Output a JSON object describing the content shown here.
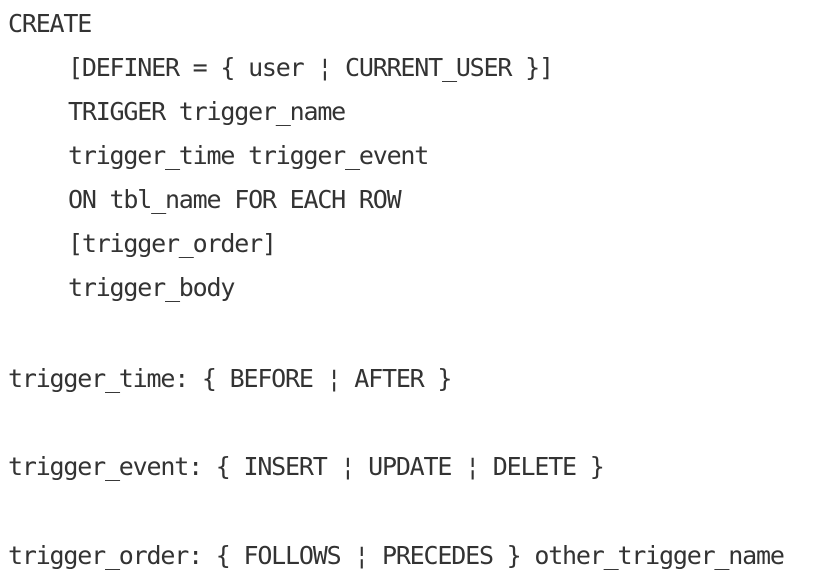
{
  "syntax": {
    "create": "CREATE",
    "definer": "[DEFINER = { user ¦ CURRENT_USER }]",
    "trigger": "TRIGGER trigger_name",
    "time_event": "trigger_time trigger_event",
    "on_table": "ON tbl_name FOR EACH ROW",
    "order_opt": "[trigger_order]",
    "body": "trigger_body",
    "time_def": "trigger_time: { BEFORE ¦ AFTER }",
    "event_def": "trigger_event: { INSERT ¦ UPDATE ¦ DELETE }",
    "order_def": "trigger_order: { FOLLOWS ¦ PRECEDES } other_trigger_name"
  }
}
